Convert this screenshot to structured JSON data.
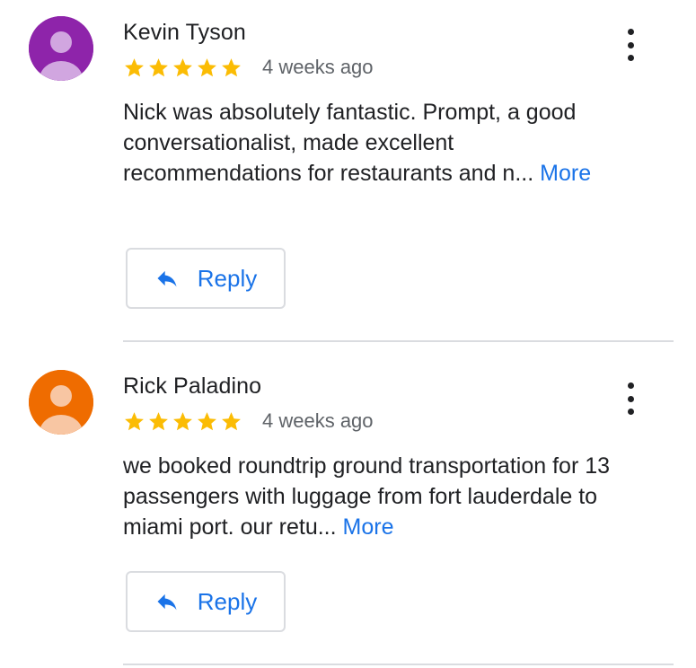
{
  "reviews": [
    {
      "name": "Kevin Tyson",
      "avatar_color": "#8e24aa",
      "avatar_figure_color": "#d1a6e0",
      "rating": 5,
      "date": "4 weeks ago",
      "text": "Nick was absolutely fantastic. Prompt, a good conversationalist, made excellent recommendations for restaurants and n...",
      "more_label": "More",
      "reply_label": "Reply"
    },
    {
      "name": "Rick Paladino",
      "avatar_color": "#ef6c00",
      "avatar_figure_color": "#f8c6a3",
      "rating": 5,
      "date": "4 weeks ago",
      "text": "we booked roundtrip ground transportation for 13 passengers with luggage from fort lauderdale to miami port. our retu...",
      "more_label": "More",
      "reply_label": "Reply"
    }
  ],
  "colors": {
    "star": "#fbbc04",
    "link": "#1a73e8",
    "divider": "#dadce0"
  },
  "icons": {
    "menu": "more-vert-icon",
    "reply": "reply-arrow-icon",
    "star": "star-icon"
  }
}
